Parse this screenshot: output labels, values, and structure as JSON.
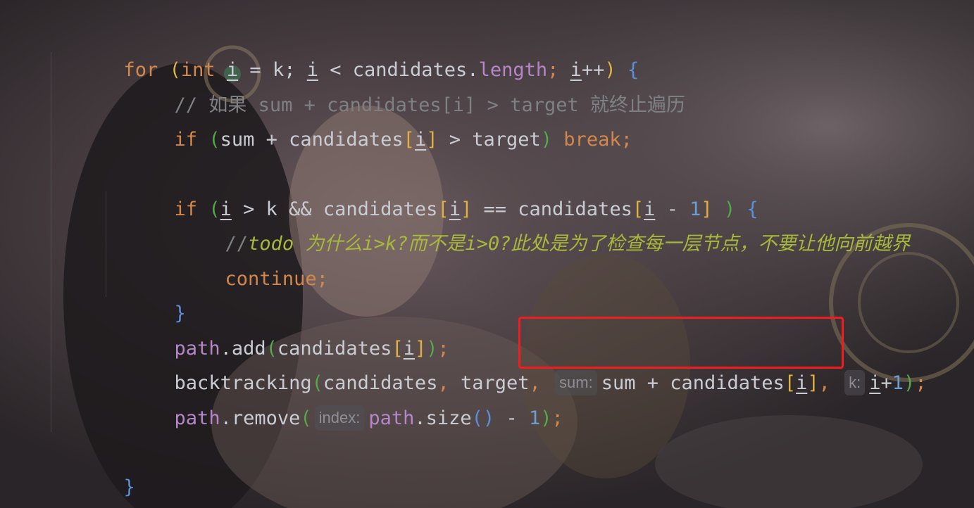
{
  "lines": {
    "l1": {
      "kw_for": "for",
      "p_open": "(",
      "kw_int": "int",
      "sp1": " ",
      "var_i1": "i",
      "eq": " = k; ",
      "var_i2": "i",
      "lt": " < candidates.",
      "length": "length",
      "semi": "; ",
      "var_i3": "i",
      "pp": "++",
      "p_close": ")",
      "brace": " {"
    },
    "l2": {
      "comment": "// 如果 sum + candidates[i] > target 就终止遍历"
    },
    "l3": {
      "kw_if": "if",
      "p_open": " (",
      "expr": "sum + candidates",
      "b_open": "[",
      "var_i": "i",
      "b_close": "]",
      "gt": " > target",
      "p_close": ")",
      "kw_break": " break",
      "semi": ";"
    },
    "l4": {
      "kw_if": "if",
      "p_open": " (",
      "var_i1": "i",
      "cmp": " > k && candidates",
      "b1_open": "[",
      "var_i2": "i",
      "b1_close": "]",
      "eqeq": " == candidates",
      "b2_open": "[",
      "var_i3": "i",
      "minus": " - ",
      "one": "1",
      "b2_close": "]",
      "p_close": " )",
      "brace": " {"
    },
    "l5": {
      "slashes": "//",
      "todo": "todo 为什么i>k?而不是i>0?此处是为了检查每一层节点，不要让他向前越界"
    },
    "l6": {
      "kw_continue": "continue",
      "semi": ";"
    },
    "l7": {
      "brace": "}"
    },
    "l8": {
      "path": "path",
      "add": ".add",
      "p_open": "(",
      "cand": "candidates",
      "b_open": "[",
      "var_i": "i",
      "b_close": "]",
      "p_close": ")",
      "semi": ";"
    },
    "l9": {
      "fn": "backtracking",
      "p_open": "(",
      "args1": "candidates",
      "comma1": ", ",
      "args2": "target",
      "comma2": ", ",
      "hint_sum": "sum:",
      "sum_expr": "sum + candidates",
      "b_open": "[",
      "var_i1": "i",
      "b_close": "]",
      "comma3": ", ",
      "hint_k": "k:",
      "var_i2": "i",
      "plus": "+",
      "one": "1",
      "p_close": ")",
      "semi": ";"
    },
    "l10": {
      "path": "path",
      "remove": ".remove",
      "p_open": "(",
      "hint_index": "index:",
      "path2": "path",
      "size": ".size",
      "pp": "()",
      "minus": " - ",
      "one": "1",
      "p_close": ")",
      "semi": ";"
    },
    "l11": {
      "brace": "}"
    },
    "l12": {
      "brace": "}"
    }
  },
  "colors": {
    "keyword": "#d4874a",
    "text": "#c9ccd3",
    "field": "#b586c9",
    "number": "#6a9fd4",
    "comment": "#7f8083",
    "todo": "#a8b83a",
    "highlight": "#f01e1e"
  }
}
